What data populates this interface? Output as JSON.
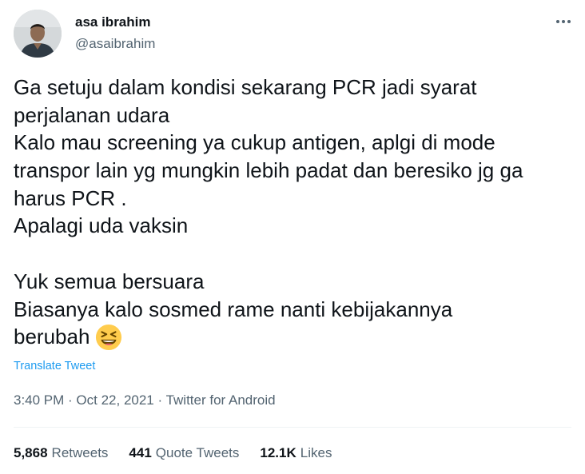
{
  "author": {
    "name": "asa ibrahim",
    "handle": "@asaibrahim"
  },
  "tweet": {
    "lines": [
      "Ga setuju dalam kondisi sekarang PCR jadi syarat",
      "perjalanan udara",
      "Kalo mau screening ya cukup antigen, aplgi di mode",
      "transpor lain yg mungkin lebih padat dan beresiko jg ga",
      "harus PCR .",
      "Apalagi uda vaksin",
      "",
      "Yuk semua bersuara",
      "Biasanya kalo sosmed rame nanti kebijakannya",
      "berubah"
    ],
    "emoji_icon": "grinning-squinting-face-icon",
    "translate_label": "Translate Tweet"
  },
  "meta": {
    "time": "3:40 PM",
    "separator": " · ",
    "date": "Oct 22, 2021",
    "source": "Twitter for Android"
  },
  "stats": {
    "retweets_count": "5,868",
    "retweets_label": "Retweets",
    "quotes_count": "441",
    "quotes_label": "Quote Tweets",
    "likes_count": "12.1K",
    "likes_label": "Likes"
  },
  "colors": {
    "text": "#0f1419",
    "secondary": "#536471",
    "link": "#1d9bf0",
    "divider": "#eff3f4"
  }
}
